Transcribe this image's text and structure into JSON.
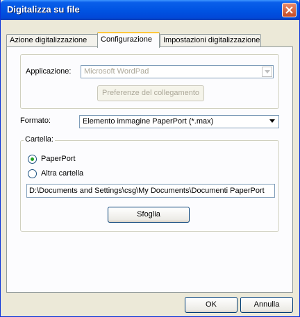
{
  "window": {
    "title": "Digitalizza su file"
  },
  "tabs": [
    {
      "label": "Azione digitalizzazione",
      "active": false
    },
    {
      "label": "Configurazione",
      "active": true
    },
    {
      "label": "Impostazioni digitalizzazione",
      "active": false
    }
  ],
  "application": {
    "label": "Applicazione:",
    "value": "Microsoft WordPad",
    "enabled": false,
    "link_prefs_button": "Preferenze del collegamento"
  },
  "format": {
    "label": "Formato:",
    "value": "Elemento immagine PaperPort (*.max)"
  },
  "folder": {
    "group_label": "Cartella:",
    "options": [
      {
        "label": "PaperPort",
        "selected": true
      },
      {
        "label": "Altra cartella",
        "selected": false
      }
    ],
    "path": "D:\\Documents and Settings\\csg\\My Documents\\Documenti PaperPort",
    "browse_button": "Sfoglia"
  },
  "footer": {
    "ok_button": "OK",
    "cancel_button": "Annulla"
  },
  "icons": {
    "close": "close-icon",
    "dropdown": "chevron-down-icon"
  },
  "colors": {
    "titlebar": "#0054e3",
    "dialog_bg": "#ece9d8",
    "close_button": "#c54b24",
    "active_tab_accent": "#ffc83c",
    "radio_dot": "#21a121"
  }
}
